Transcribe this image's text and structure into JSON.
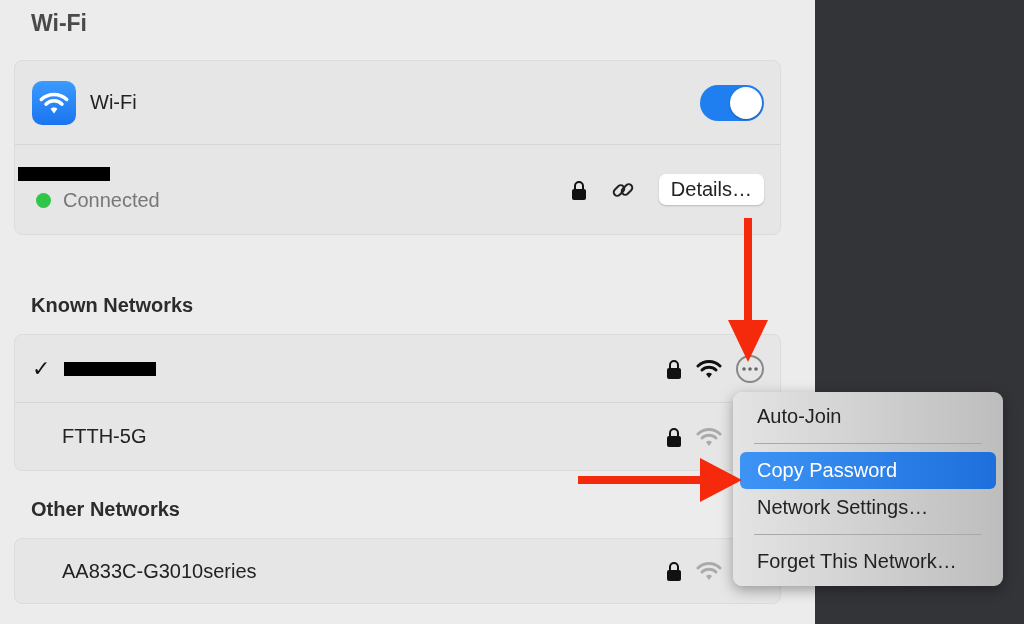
{
  "title": "Wi-Fi",
  "wifi": {
    "label": "Wi-Fi",
    "on": true
  },
  "current": {
    "redacted": true,
    "status": "Connected",
    "secure": true,
    "details_button": "Details…"
  },
  "known_networks": {
    "heading": "Known Networks",
    "items": [
      {
        "redacted": true,
        "check": "✓",
        "connected": true,
        "secure": true
      },
      {
        "redacted": false,
        "name": "FTTH-5G",
        "connected": false,
        "secure": true
      }
    ]
  },
  "other_networks": {
    "heading": "Other Networks",
    "items": [
      {
        "redacted": false,
        "name": "AA833C-G3010series",
        "connected": false,
        "secure": true
      }
    ]
  },
  "context_menu": {
    "items": [
      {
        "kind": "item",
        "label": "Auto-Join",
        "selected": false
      },
      {
        "kind": "separator"
      },
      {
        "kind": "item",
        "label": "Copy Password",
        "selected": true
      },
      {
        "kind": "item",
        "label": "Network Settings…",
        "selected": false
      },
      {
        "kind": "separator"
      },
      {
        "kind": "item",
        "label": "Forget This Network…",
        "selected": false
      }
    ]
  }
}
